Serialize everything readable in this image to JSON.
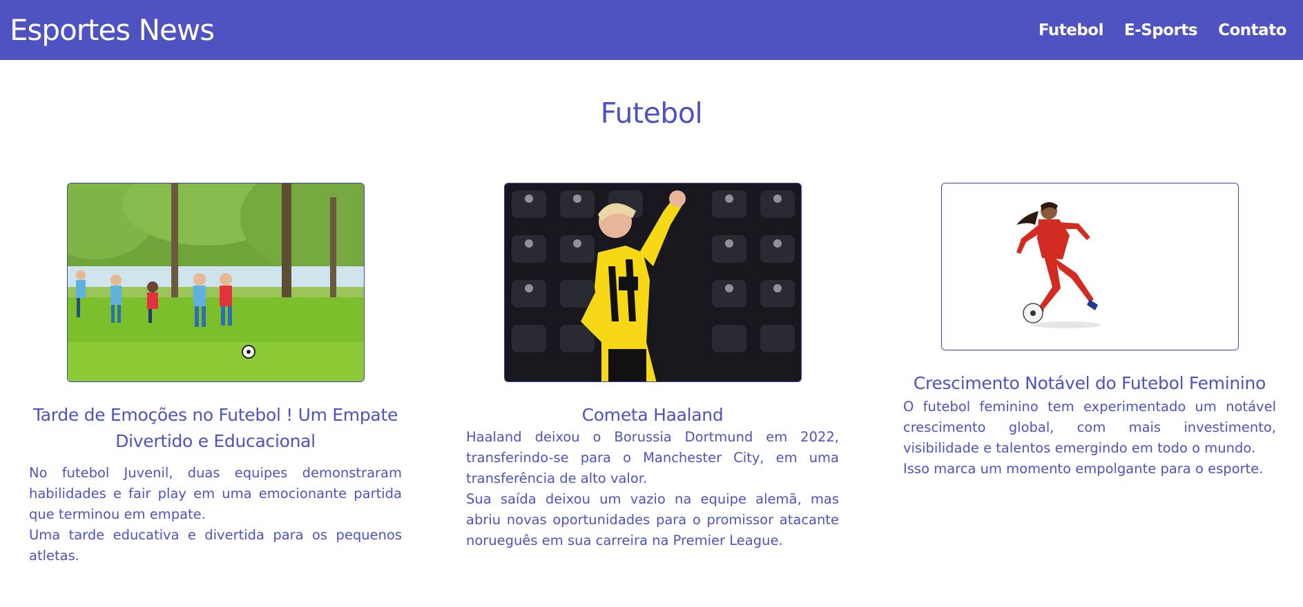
{
  "header": {
    "brand": "Esportes News",
    "nav": [
      {
        "label": "Futebol"
      },
      {
        "label": "E-Sports"
      },
      {
        "label": "Contato"
      }
    ]
  },
  "section": {
    "title": "Futebol"
  },
  "cards": [
    {
      "title": "Tarde de Emoções no Futebol ! Um Empate Divertido e Educacional",
      "paragraphs": [
        "No futebol Juvenil, duas equipes demonstraram habilidades e fair play em uma emocionante partida que terminou em empate.",
        "Uma tarde educativa e divertida para os pequenos atletas."
      ],
      "image_alt": "kids-football-photo"
    },
    {
      "title": "Cometa Haaland",
      "paragraphs": [
        "Haaland deixou o Borussia Dortmund em 2022, transferindo-se para o Manchester City, em uma transferência de alto valor.",
        "Sua saída deixou um vazio na equipe alemã, mas abriu novas oportunidades para o promissor atacante norueguês em sua carreira na Premier League."
      ],
      "image_alt": "haaland-photo"
    },
    {
      "title": "Crescimento Notável do Futebol Feminino",
      "paragraphs": [
        "O futebol feminino tem experimentado um notável crescimento global, com mais investimento, visibilidade e talentos emergindo em todo o mundo.",
        "Isso marca um momento empolgante para o esporte."
      ],
      "image_alt": "female-player-photo"
    }
  ],
  "colors": {
    "primary": "#4f53c2",
    "text": "#4e52c0",
    "background": "#ffffff"
  }
}
